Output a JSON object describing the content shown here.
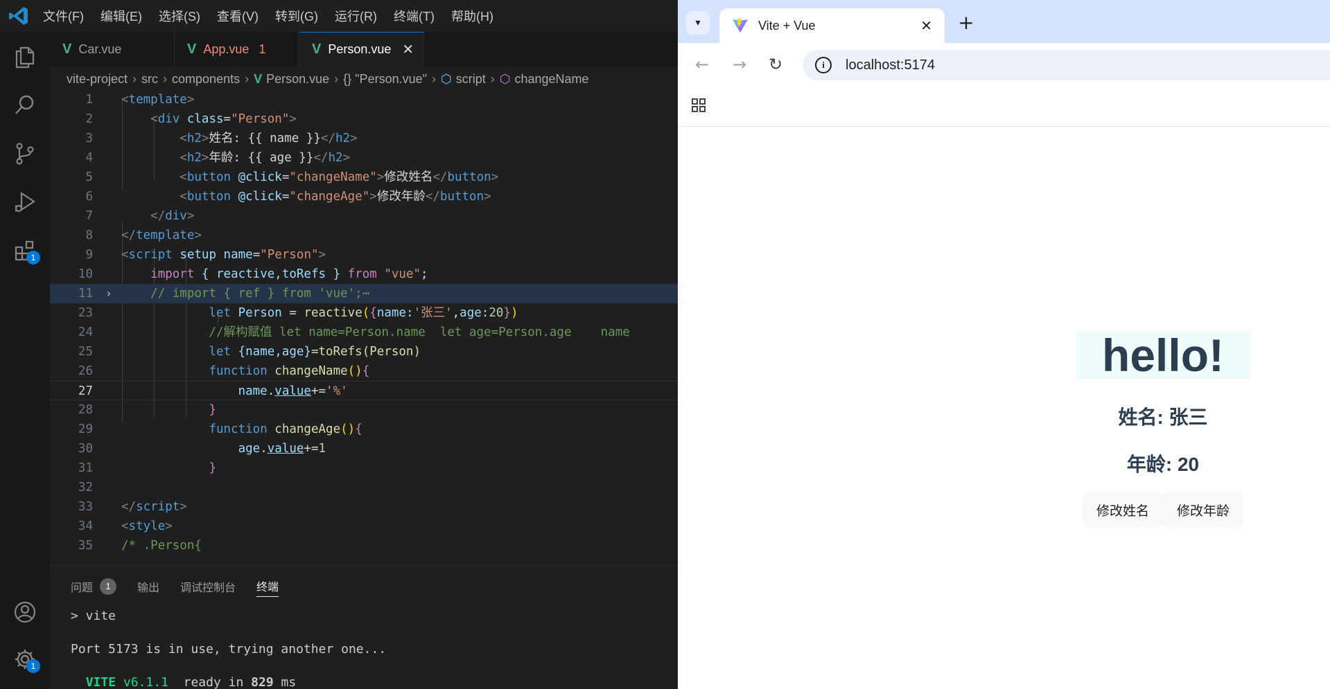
{
  "vscode": {
    "menu": [
      "文件(F)",
      "编辑(E)",
      "选择(S)",
      "查看(V)",
      "转到(G)",
      "运行(R)",
      "终端(T)",
      "帮助(H)"
    ],
    "tabs": [
      {
        "name": "Car.vue"
      },
      {
        "name": "App.vue",
        "count": "1"
      },
      {
        "name": "Person.vue"
      }
    ],
    "breadcrumb": [
      "vite-project",
      "src",
      "components",
      "Person.vue",
      "{} \"Person.vue\"",
      "script",
      "changeName"
    ],
    "activity_badges": {
      "extensions": "1",
      "settings": "1"
    },
    "line_numbers": [
      "1",
      "2",
      "3",
      "4",
      "5",
      "6",
      "7",
      "8",
      "9",
      "10",
      "11",
      "23",
      "24",
      "25",
      "26",
      "27",
      "28",
      "29",
      "30",
      "31",
      "32",
      "33",
      "34",
      "35"
    ],
    "code": {
      "l1": "<template>",
      "l2_open": "<div",
      "l2_attr": "class",
      "l2_val": "\"Person\"",
      "l3_text": "姓名: {{ name }}",
      "l4_text": "年龄: {{ age }}",
      "l5_attr": "@click",
      "l5_val": "\"changeName\"",
      "l5_text": "修改姓名",
      "l6_attr": "@click",
      "l6_val": "\"changeAge\"",
      "l6_text": "修改年龄",
      "l9_attr": "name",
      "l9_val": "\"Person\"",
      "l10_names": "{ reactive,toRefs }",
      "l10_from": "\"vue\"",
      "l11": "// import { ref } from 'vue';⋯",
      "l23_str": "'张三'",
      "l23_num": "20",
      "l24": "//解构赋值 let name=Person.name  let age=Person.age    name",
      "l25_names": "{name,age}",
      "l25_rest": "=toRefs(Person)",
      "l27_str": "'%'",
      "l30_num": "1",
      "l35": "/* .Person{"
    },
    "panel": {
      "tabs": [
        "问题",
        "输出",
        "调试控制台",
        "终端"
      ],
      "problems_count": "1",
      "terminal": {
        "cmd": "> vite",
        "msg": "Port 5173 is in use, trying another one...",
        "vite_label": "VITE",
        "vite_version": "v6.1.1",
        "ready": "ready in",
        "ms_value": "829",
        "ms_unit": "ms"
      }
    }
  },
  "browser": {
    "tab_title": "Vite + Vue",
    "url": "localhost:5174",
    "page": {
      "hello": "hello!",
      "name_line": "姓名: 张三",
      "age_line": "年龄: 20",
      "btn_name": "修改姓名",
      "btn_age": "修改年龄"
    }
  }
}
